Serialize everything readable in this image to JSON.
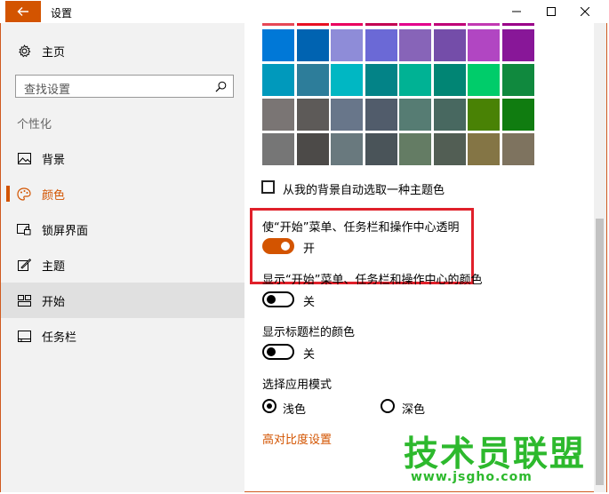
{
  "window": {
    "title": "设置",
    "controls": {
      "minimize": "minimize-icon",
      "maximize": "maximize-icon",
      "close": "close-icon"
    }
  },
  "sidebar": {
    "home_label": "主页",
    "search_placeholder": "查找设置",
    "section_heading": "个性化",
    "items": [
      {
        "label": "背景",
        "icon": "picture-icon",
        "selected": false,
        "current": false
      },
      {
        "label": "颜色",
        "icon": "palette-icon",
        "selected": false,
        "current": true
      },
      {
        "label": "锁屏界面",
        "icon": "lockscreen-icon",
        "selected": false,
        "current": false
      },
      {
        "label": "主题",
        "icon": "brush-icon",
        "selected": false,
        "current": false
      },
      {
        "label": "开始",
        "icon": "start-icon",
        "selected": true,
        "current": false
      },
      {
        "label": "任务栏",
        "icon": "taskbar-icon",
        "selected": false,
        "current": false
      }
    ]
  },
  "colors": {
    "accent": "#d35400",
    "grid": [
      [
        "#0078d7",
        "#0063b1",
        "#8e8cd8",
        "#6b69d6",
        "#8764b8",
        "#744da9",
        "#b146c2",
        "#881798"
      ],
      [
        "#0099bc",
        "#2d7d9a",
        "#00b7c3",
        "#038387",
        "#00b294",
        "#018574",
        "#00cc6a",
        "#10893e"
      ],
      [
        "#7a7574",
        "#5d5a58",
        "#68768a",
        "#515c6b",
        "#567c73",
        "#486860",
        "#498205",
        "#107c10"
      ],
      [
        "#767676",
        "#4c4a48",
        "#69797e",
        "#4a5459",
        "#647c64",
        "#525e54",
        "#847545",
        "#7e735f"
      ]
    ],
    "top_strip": [
      "#e74856",
      "#e81123",
      "#ea005e",
      "#c30052",
      "#e3008c",
      "#bf0077",
      "#c239b3",
      "#9a0089"
    ]
  },
  "content": {
    "auto_accent_label": "从我的背景自动选取一种主题色",
    "transparency": {
      "label": "使“开始”菜单、任务栏和操作中心透明",
      "state": "开"
    },
    "start_color": {
      "label": "显示“开始”菜单、任务栏和操作中心的颜色",
      "state": "关"
    },
    "titlebar_color": {
      "label": "显示标题栏的颜色",
      "state": "关"
    },
    "app_mode": {
      "label": "选择应用模式",
      "options": [
        "浅色",
        "深色"
      ],
      "selected": "浅色"
    },
    "high_contrast_link": "高对比度设置"
  },
  "watermark": {
    "text": "技术员联盟",
    "url": "www.jsgho.com"
  }
}
